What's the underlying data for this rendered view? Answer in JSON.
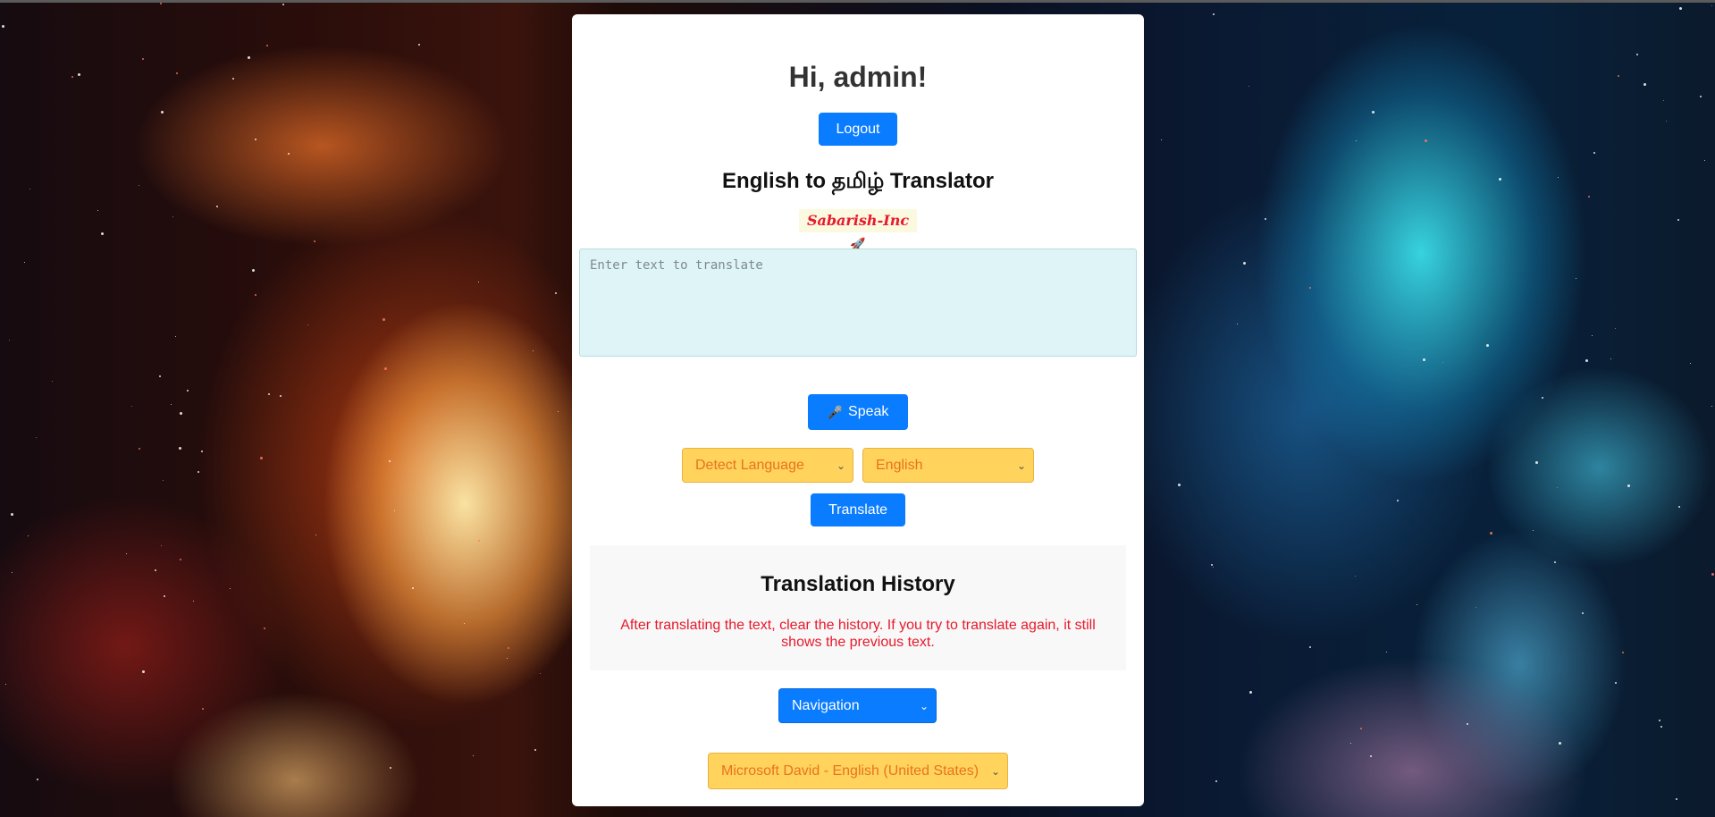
{
  "page": {
    "greeting": "Hi, admin!",
    "logout_label": "Logout",
    "subtitle": "English to தமிழ் Translator",
    "brand": "Sabarish-Inc",
    "brand_emoji": "🚀"
  },
  "translator": {
    "input_placeholder": "Enter text to translate",
    "input_value": "",
    "speak_icon": "🎤",
    "speak_label": "Speak",
    "from_language": "Detect Language",
    "to_language": "English",
    "translate_label": "Translate"
  },
  "history": {
    "title": "Translation History",
    "note": "After translating the text, clear the history. If you try to translate again, it still shows the previous text."
  },
  "navigation": {
    "selected": "Navigation"
  },
  "voice": {
    "selected": "Microsoft David - English (United States)"
  },
  "colors": {
    "primary_button": "#0a7cff",
    "select_yellow": "#ffd35c",
    "select_text_orange": "#e8731f",
    "note_red": "#e8192c",
    "textarea_bg": "#dff4f7"
  },
  "icons": {
    "speak": "microphone-icon",
    "brand": "rocket-icon",
    "dropdown": "chevron-down-icon"
  }
}
